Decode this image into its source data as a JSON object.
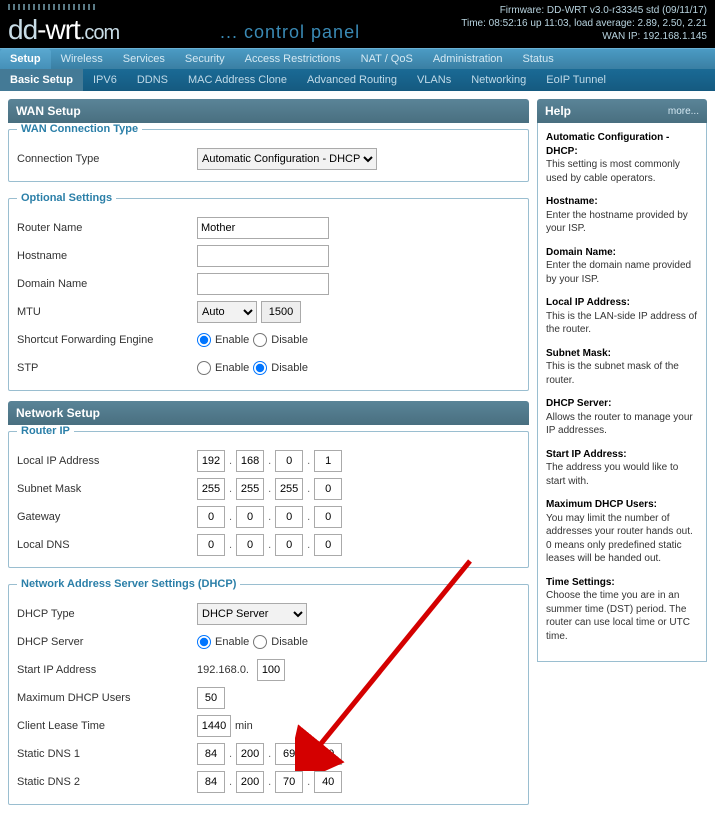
{
  "header": {
    "logo_dd": "dd",
    "logo_wrt": "-wrt",
    "logo_com": ".com",
    "control_panel": "... control panel",
    "firmware": "Firmware: DD-WRT v3.0-r33345 std (09/11/17)",
    "time": "Time: 08:52:16 up 11:03, load average: 2.89, 2.50, 2.21",
    "wanip": "WAN IP: 192.168.1.145"
  },
  "tabs_primary": [
    "Setup",
    "Wireless",
    "Services",
    "Security",
    "Access Restrictions",
    "NAT / QoS",
    "Administration",
    "Status"
  ],
  "tabs_primary_active": 0,
  "tabs_secondary": [
    "Basic Setup",
    "IPV6",
    "DDNS",
    "MAC Address Clone",
    "Advanced Routing",
    "VLANs",
    "Networking",
    "EoIP Tunnel"
  ],
  "tabs_secondary_active": 0,
  "wan_setup": {
    "title": "WAN Setup",
    "connection_legend": "WAN Connection Type",
    "connection_type_label": "Connection Type",
    "connection_type_value": "Automatic Configuration - DHCP",
    "optional_legend": "Optional Settings",
    "router_name_label": "Router Name",
    "router_name_value": "Mother",
    "hostname_label": "Hostname",
    "hostname_value": "",
    "domain_label": "Domain Name",
    "domain_value": "",
    "mtu_label": "MTU",
    "mtu_mode": "Auto",
    "mtu_value": "1500",
    "sfe_label": "Shortcut Forwarding Engine",
    "stp_label": "STP",
    "enable": "Enable",
    "disable": "Disable"
  },
  "network_setup": {
    "title": "Network Setup",
    "router_ip_legend": "Router IP",
    "local_ip_label": "Local IP Address",
    "local_ip": [
      "192",
      "168",
      "0",
      "1"
    ],
    "subnet_label": "Subnet Mask",
    "subnet": [
      "255",
      "255",
      "255",
      "0"
    ],
    "gateway_label": "Gateway",
    "gateway": [
      "0",
      "0",
      "0",
      "0"
    ],
    "localdns_label": "Local DNS",
    "localdns": [
      "0",
      "0",
      "0",
      "0"
    ],
    "dhcp_legend": "Network Address Server Settings (DHCP)",
    "dhcp_type_label": "DHCP Type",
    "dhcp_type_value": "DHCP Server",
    "dhcp_server_label": "DHCP Server",
    "start_ip_label": "Start IP Address",
    "start_ip_prefix": "192.168.0.",
    "start_ip_value": "100",
    "max_users_label": "Maximum DHCP Users",
    "max_users_value": "50",
    "lease_label": "Client Lease Time",
    "lease_value": "1440",
    "lease_unit": "min",
    "dns1_label": "Static DNS 1",
    "dns1": [
      "84",
      "200",
      "69",
      "80"
    ],
    "dns2_label": "Static DNS 2",
    "dns2": [
      "84",
      "200",
      "70",
      "40"
    ]
  },
  "help": {
    "title": "Help",
    "more": "more...",
    "items": [
      {
        "t": "Automatic Configuration - DHCP:",
        "d": "This setting is most commonly used by cable operators."
      },
      {
        "t": "Hostname:",
        "d": "Enter the hostname provided by your ISP."
      },
      {
        "t": "Domain Name:",
        "d": "Enter the domain name provided by your ISP."
      },
      {
        "t": "Local IP Address:",
        "d": "This is the LAN-side IP address of the router."
      },
      {
        "t": "Subnet Mask:",
        "d": "This is the subnet mask of the router."
      },
      {
        "t": "DHCP Server:",
        "d": "Allows the router to manage your IP addresses."
      },
      {
        "t": "Start IP Address:",
        "d": "The address you would like to start with."
      },
      {
        "t": "Maximum DHCP Users:",
        "d": "You may limit the number of addresses your router hands out. 0 means only predefined static leases will be handed out."
      },
      {
        "t": "Time Settings:",
        "d": "Choose the time you are in an summer time (DST) period. The router can use local time or UTC time."
      }
    ]
  }
}
